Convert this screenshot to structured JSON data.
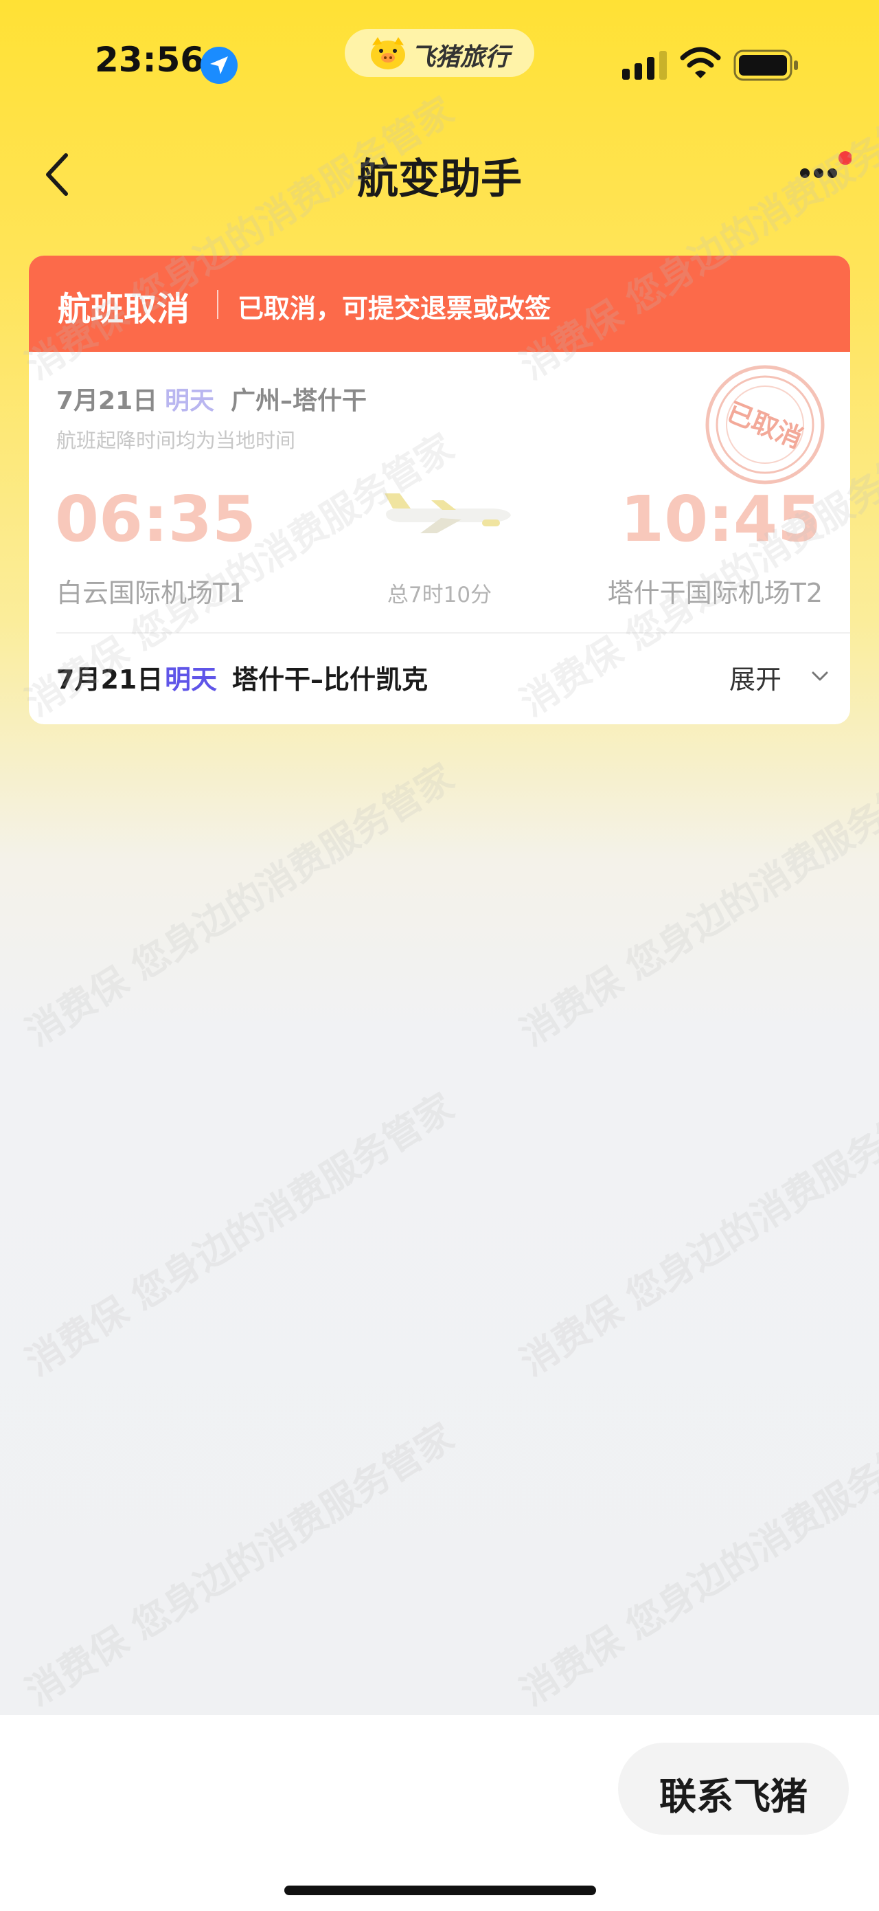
{
  "status_bar": {
    "time": "23:56",
    "app_name": "飞猪旅行",
    "icons": [
      "location-arrow-icon",
      "pig-logo-icon",
      "signal-icon",
      "wifi-icon",
      "battery-icon"
    ]
  },
  "nav": {
    "title": "航变助手",
    "icons": [
      "back-chevron-icon",
      "more-icon"
    ],
    "notification_dot_color": "#f43d3d"
  },
  "card": {
    "status_title": "航班取消",
    "status_desc": "已取消，可提交退票或改签",
    "header_color": "#fc6a4a",
    "segment1": {
      "date": "7月21日",
      "day": "明天",
      "route": "广州–塔什干",
      "time_note": "航班起降时间均为当地时间",
      "departure_time": "06:35",
      "arrival_time": "10:45",
      "departure_airport": "白云国际机场T1",
      "arrival_airport": "塔什干国际机场T2",
      "duration": "总7时10分",
      "stamp_text": "已取消"
    },
    "segment2": {
      "date": "7月21日",
      "day": "明天",
      "route": "塔什干–比什凯克",
      "expand_label": "展开"
    }
  },
  "watermark": {
    "text": "消费保 您身边的消费服务管家"
  },
  "footer": {
    "contact_label": "联系飞猪"
  },
  "colors": {
    "accent_yellow": "#ffe135",
    "day_accent": "#5f55e8",
    "stamp": "#f3a999"
  }
}
